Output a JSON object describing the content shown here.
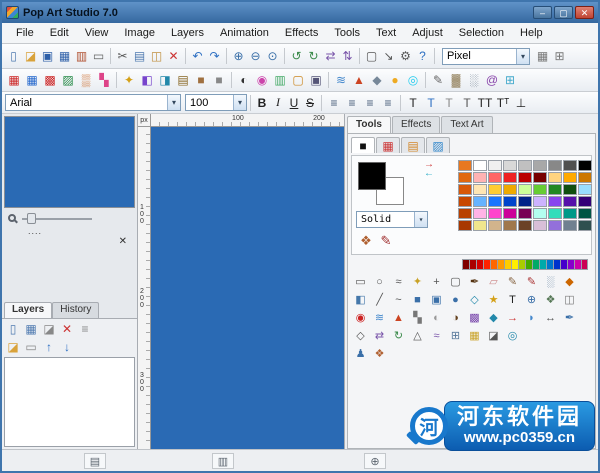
{
  "window": {
    "title": "Pop Art Studio 7.0",
    "minimize_glyph": "–",
    "maximize_glyph": "▢",
    "close_glyph": "✕"
  },
  "menu": {
    "items": [
      "File",
      "Edit",
      "View",
      "Image",
      "Layers",
      "Animation",
      "Effects",
      "Tools",
      "Text",
      "Adjust",
      "Selection",
      "Help"
    ]
  },
  "ui": {
    "dropdown_arrow": "▾"
  },
  "toolbar1": {
    "unit_value": "Pixel",
    "groups": [
      [
        {
          "n": "new-document-icon",
          "g": "▯",
          "c": "#4f7ab0"
        },
        {
          "n": "open-folder-icon",
          "g": "◪",
          "c": "#d9a23a"
        },
        {
          "n": "save-icon",
          "g": "▣",
          "c": "#2d5fa8"
        },
        {
          "n": "save-all-icon",
          "g": "▦",
          "c": "#2d5fa8"
        },
        {
          "n": "export-icon",
          "g": "▥",
          "c": "#b05030"
        },
        {
          "n": "print-icon",
          "g": "▭",
          "c": "#666666"
        }
      ],
      [
        {
          "n": "cut-icon",
          "g": "✂",
          "c": "#555555"
        },
        {
          "n": "copy-icon",
          "g": "▤",
          "c": "#4f7ab0"
        },
        {
          "n": "paste-icon",
          "g": "◫",
          "c": "#c09040"
        },
        {
          "n": "delete-icon",
          "g": "✕",
          "c": "#cc3333"
        }
      ],
      [
        {
          "n": "undo-icon",
          "g": "↶",
          "c": "#2d6fc2"
        },
        {
          "n": "redo-icon",
          "g": "↷",
          "c": "#2d6fc2"
        }
      ],
      [
        {
          "n": "zoom-in-icon",
          "g": "⊕",
          "c": "#3a6fa8"
        },
        {
          "n": "zoom-out-icon",
          "g": "⊖",
          "c": "#3a6fa8"
        },
        {
          "n": "zoom-actual-icon",
          "g": "⊙",
          "c": "#3a6fa8"
        }
      ],
      [
        {
          "n": "rotate-left-icon",
          "g": "↺",
          "c": "#3a8a4a"
        },
        {
          "n": "rotate-right-icon",
          "g": "↻",
          "c": "#3a8a4a"
        },
        {
          "n": "flip-horizontal-icon",
          "g": "⇄",
          "c": "#7a55aa"
        },
        {
          "n": "flip-vertical-icon",
          "g": "⇅",
          "c": "#7a55aa"
        }
      ],
      [
        {
          "n": "crop-icon",
          "g": "▢",
          "c": "#555555"
        },
        {
          "n": "resize-icon",
          "g": "↘",
          "c": "#555555"
        },
        {
          "n": "gear-icon",
          "g": "⚙",
          "c": "#555555"
        },
        {
          "n": "help-icon",
          "g": "?",
          "c": "#2d6fc2"
        }
      ],
      [
        {
          "n": "grid-icon",
          "g": "▦",
          "c": "#777777"
        },
        {
          "n": "table-icon",
          "g": "⊞",
          "c": "#777777"
        }
      ]
    ]
  },
  "toolbar2": {
    "groups": [
      [
        {
          "n": "popart-effect-icon",
          "g": "▦",
          "c": "#cc2222"
        },
        {
          "n": "warhol-effect-icon",
          "g": "▦",
          "c": "#2266cc"
        },
        {
          "n": "flag-effect-icon",
          "g": "▩",
          "c": "#cc2222"
        },
        {
          "n": "checker-effect-icon",
          "g": "▨",
          "c": "#228844"
        },
        {
          "n": "halftone-effect-icon",
          "g": "▒",
          "c": "#cc6622"
        },
        {
          "n": "comic-effect-icon",
          "g": "▚",
          "c": "#dd4488"
        }
      ],
      [
        {
          "n": "stars-effect-icon",
          "g": "✦",
          "c": "#d4a017"
        },
        {
          "n": "rainbow-effect-icon",
          "g": "◧",
          "c": "#7744cc"
        },
        {
          "n": "gradient-effect-icon",
          "g": "◨",
          "c": "#2288aa"
        },
        {
          "n": "mosaic-effect-icon",
          "g": "▤",
          "c": "#886622"
        },
        {
          "n": "sepia-effect-icon",
          "g": "■",
          "c": "#a07040"
        },
        {
          "n": "grayscale-effect-icon",
          "g": "■",
          "c": "#888888"
        }
      ],
      [
        {
          "n": "invert-effect-icon",
          "g": "◐",
          "c": "#333333"
        },
        {
          "n": "colorize-effect-icon",
          "g": "◉",
          "c": "#cc44aa"
        },
        {
          "n": "posterize-effect-icon",
          "g": "▥",
          "c": "#44aa66"
        },
        {
          "n": "frame-effect-icon",
          "g": "▢",
          "c": "#cc8822"
        },
        {
          "n": "shadow-effect-icon",
          "g": "▣",
          "c": "#555577"
        }
      ],
      [
        {
          "n": "blur-effect-icon",
          "g": "≋",
          "c": "#4488cc"
        },
        {
          "n": "sharpen-effect-icon",
          "g": "▲",
          "c": "#cc4422"
        },
        {
          "n": "emboss-effect-icon",
          "g": "◆",
          "c": "#778899"
        },
        {
          "n": "glow-effect-icon",
          "g": "●",
          "c": "#eeaa22"
        },
        {
          "n": "neon-effect-icon",
          "g": "◎",
          "c": "#22ccee"
        }
      ],
      [
        {
          "n": "sketch-effect-icon",
          "g": "✎",
          "c": "#666666"
        },
        {
          "n": "canvas-effect-icon",
          "g": "▓",
          "c": "#998866"
        },
        {
          "n": "noise-effect-icon",
          "g": "░",
          "c": "#667788"
        },
        {
          "n": "swirl-effect-icon",
          "g": "@",
          "c": "#8844aa"
        },
        {
          "n": "tile-effect-icon",
          "g": "⊞",
          "c": "#44aacc"
        }
      ]
    ]
  },
  "fontbar": {
    "font_name": "Arial",
    "font_size": "100",
    "style_buttons": [
      "B",
      "I",
      "U",
      "S"
    ],
    "align_icons": [
      {
        "n": "align-left-icon",
        "g": "≡",
        "c": "#445a77"
      },
      {
        "n": "align-center-icon",
        "g": "≡",
        "c": "#445a77"
      },
      {
        "n": "align-right-icon",
        "g": "≡",
        "c": "#445a77"
      },
      {
        "n": "align-justify-icon",
        "g": "≡",
        "c": "#445a77"
      }
    ],
    "text_icons": [
      {
        "n": "text-plain-icon",
        "g": "T",
        "c": "#222222"
      },
      {
        "n": "text-color-icon",
        "g": "T",
        "c": "#2d6fc2"
      },
      {
        "n": "text-outline-icon",
        "g": "T",
        "c": "#888888"
      },
      {
        "n": "text-shadow-icon",
        "g": "T",
        "c": "#555555"
      },
      {
        "n": "text-caps-icon",
        "g": "TT",
        "c": "#222222"
      },
      {
        "n": "text-superscript-icon",
        "g": "Tᵀ",
        "c": "#222222"
      },
      {
        "n": "text-rotate-icon",
        "g": "⊥",
        "c": "#222222"
      }
    ]
  },
  "left": {
    "dots_label": "....",
    "close_glyph": "✕",
    "tabs": [
      "Layers",
      "History"
    ],
    "layer_icons_row1": [
      {
        "n": "new-layer-icon",
        "g": "▯",
        "c": "#4f7ab0"
      },
      {
        "n": "duplicate-layer-icon",
        "g": "▦",
        "c": "#4f7ab0"
      },
      {
        "n": "layer-mask-icon",
        "g": "◪",
        "c": "#888888"
      },
      {
        "n": "delete-layer-icon",
        "g": "✕",
        "c": "#cc3333"
      },
      {
        "n": "merge-layers-icon",
        "g": "≡",
        "c": "#888888"
      }
    ],
    "layer_icons_row2": [
      {
        "n": "layer-folder-icon",
        "g": "◪",
        "c": "#d9a23a"
      },
      {
        "n": "flatten-icon",
        "g": "▭",
        "c": "#888888"
      },
      {
        "n": "layer-up-icon",
        "g": "↑",
        "c": "#2d6fc2"
      },
      {
        "n": "layer-down-icon",
        "g": "↓",
        "c": "#2d6fc2"
      }
    ]
  },
  "canvas": {
    "unit": "px",
    "h_labels": [
      "100",
      "200"
    ],
    "v_labels": [
      "1\n0\n0",
      "2\n0\n0",
      "3\n0\n0"
    ],
    "color": "#2a6ab4"
  },
  "right": {
    "tabs": [
      "Tools",
      "Effects",
      "Text Art"
    ],
    "palette_tabs": [
      {
        "n": "palette-tab-solid-icon",
        "g": "■",
        "c": "#111111"
      },
      {
        "n": "palette-tab-swatch-icon",
        "g": "▦",
        "c": "#cc3333"
      },
      {
        "n": "palette-tab-mixer-icon",
        "g": "▤",
        "c": "#d4882a"
      },
      {
        "n": "palette-tab-web-icon",
        "g": "▨",
        "c": "#3388cc"
      }
    ],
    "foreground_color": "#000000",
    "background_color": "#ffffff",
    "swap_glyph1": "→",
    "swap_glyph2": "←",
    "fill_style": "Solid",
    "palette_icons": [
      {
        "n": "artist-palette-icon",
        "g": "❖",
        "c": "#b06030"
      },
      {
        "n": "brushes-icon",
        "g": "✎",
        "c": "#a03030"
      }
    ],
    "palette_rows": [
      [
        "#e87820",
        "#ffffff",
        "#f0f0f0",
        "#d8d8d8",
        "#c0c0c0",
        "#a8a8a8",
        "#888888",
        "#505050",
        "#000000"
      ],
      [
        "#e06810",
        "#ffb3b3",
        "#ff6666",
        "#ee2222",
        "#bb0000",
        "#770000",
        "#ffd480",
        "#ffaa00",
        "#cc7700"
      ],
      [
        "#d85808",
        "#ffe6b3",
        "#ffcc33",
        "#eeaa00",
        "#ccff99",
        "#66cc33",
        "#228822",
        "#0f4f0f",
        "#99ddff"
      ],
      [
        "#c84800",
        "#66b3ff",
        "#1a75ff",
        "#0044cc",
        "#002288",
        "#ccb3ff",
        "#8844ee",
        "#5511aa",
        "#330077"
      ],
      [
        "#b84000",
        "#ffb3e6",
        "#ff44cc",
        "#cc0099",
        "#770055",
        "#b3fff0",
        "#33ddbb",
        "#009988",
        "#005544"
      ],
      [
        "#a83800",
        "#f0e68c",
        "#d2b48c",
        "#a0784c",
        "#6b4226",
        "#d8bfd8",
        "#9370db",
        "#708090",
        "#2f4f4f"
      ]
    ],
    "strip": [
      "#7f0000",
      "#aa0000",
      "#d40000",
      "#ff2200",
      "#ff6600",
      "#ff9900",
      "#ffcc00",
      "#ffee00",
      "#aacc00",
      "#44aa00",
      "#00aa66",
      "#00aaaa",
      "#0077cc",
      "#0033cc",
      "#4400cc",
      "#8800cc",
      "#cc00aa",
      "#cc0055"
    ],
    "tool_rows": [
      [
        {
          "n": "rect-select-icon",
          "g": "▭",
          "c": "#555555"
        },
        {
          "n": "ellipse-select-icon",
          "g": "○",
          "c": "#555555"
        },
        {
          "n": "lasso-icon",
          "g": "≈",
          "c": "#555555"
        },
        {
          "n": "magic-wand-icon",
          "g": "✦",
          "c": "#c9a227"
        },
        {
          "n": "move-icon",
          "g": "+",
          "c": "#555555"
        },
        {
          "n": "crop-tool-icon",
          "g": "▢",
          "c": "#555555"
        },
        {
          "n": "eyedropper-icon",
          "g": "✒",
          "c": "#553311"
        },
        {
          "n": "eraser-icon",
          "g": "▱",
          "c": "#cc8888"
        },
        {
          "n": "pencil-icon",
          "g": "✎",
          "c": "#886644"
        },
        {
          "n": "brush-icon",
          "g": "✎",
          "c": "#aa3333"
        },
        {
          "n": "airbrush-icon",
          "g": "░",
          "c": "#557799"
        },
        {
          "n": "fill-icon",
          "g": "◆",
          "c": "#cc6600"
        }
      ],
      [
        {
          "n": "gradient-icon",
          "g": "◧",
          "c": "#4477aa"
        },
        {
          "n": "line-icon",
          "g": "╱",
          "c": "#555555"
        },
        {
          "n": "curve-icon",
          "g": "~",
          "c": "#555555"
        },
        {
          "n": "rectangle-icon",
          "g": "■",
          "c": "#3a6fa8"
        },
        {
          "n": "rounded-rect-icon",
          "g": "▣",
          "c": "#3a6fa8"
        },
        {
          "n": "ellipse-icon",
          "g": "●",
          "c": "#3a6fa8"
        },
        {
          "n": "polygon-icon",
          "g": "◇",
          "c": "#2288aa"
        },
        {
          "n": "star-icon",
          "g": "★",
          "c": "#d4a017"
        },
        {
          "n": "text-tool-icon",
          "g": "T",
          "c": "#222222"
        },
        {
          "n": "zoom-tool-icon",
          "g": "⊕",
          "c": "#3a6fa8"
        },
        {
          "n": "pan-icon",
          "g": "❖",
          "c": "#557755"
        },
        {
          "n": "clone-stamp-icon",
          "g": "◫",
          "c": "#777777"
        }
      ],
      [
        {
          "n": "red-eye-icon",
          "g": "◉",
          "c": "#cc2222"
        },
        {
          "n": "blur-icon",
          "g": "≋",
          "c": "#4488cc"
        },
        {
          "n": "sharpen-icon",
          "g": "▲",
          "c": "#cc4422"
        },
        {
          "n": "smudge-icon",
          "g": "▚",
          "c": "#777777"
        },
        {
          "n": "dodge-icon",
          "g": "◐",
          "c": "#999999"
        },
        {
          "n": "burn-icon",
          "g": "◑",
          "c": "#664422"
        },
        {
          "n": "pattern-icon",
          "g": "▩",
          "c": "#7744aa"
        },
        {
          "n": "shape-icon",
          "g": "◆",
          "c": "#2288aa"
        },
        {
          "n": "arrow-icon",
          "g": "→",
          "c": "#cc3333"
        },
        {
          "n": "callout-icon",
          "g": "◗",
          "c": "#4488cc"
        },
        {
          "n": "measure-icon",
          "g": "↔",
          "c": "#555555"
        },
        {
          "n": "pen-icon",
          "g": "✒",
          "c": "#3a6fa8"
        }
      ],
      [
        {
          "n": "node-edit-icon",
          "g": "◇",
          "c": "#555555"
        },
        {
          "n": "mirror-icon",
          "g": "⇄",
          "c": "#7a55aa"
        },
        {
          "n": "rotate-tool-icon",
          "g": "↻",
          "c": "#3a8a4a"
        },
        {
          "n": "perspective-icon",
          "g": "△",
          "c": "#555555"
        },
        {
          "n": "warp-icon",
          "g": "≈",
          "c": "#7a55aa"
        },
        {
          "n": "mesh-icon",
          "g": "⊞",
          "c": "#557799"
        },
        {
          "n": "frame-icon",
          "g": "▦",
          "c": "#c9a227"
        },
        {
          "n": "mask-icon",
          "g": "◪",
          "c": "#555555"
        },
        {
          "n": "color-picker-icon",
          "g": "◎",
          "c": "#2288aa"
        }
      ],
      [
        {
          "n": "person-icon",
          "g": "♟",
          "c": "#3a6fa8"
        },
        {
          "n": "mini-palette-icon",
          "g": "❖",
          "c": "#b06030"
        }
      ]
    ]
  },
  "statusbar": {
    "icons": [
      {
        "n": "status-doc-icon",
        "g": "▤"
      },
      {
        "n": "status-frame-icon",
        "g": "▥"
      },
      {
        "n": "status-zoom-icon",
        "g": "⊕"
      }
    ]
  },
  "watermark": {
    "icon_char": "河",
    "line1": "河东软件园",
    "line2": "www.pc0359.cn",
    "color": "#1473c8"
  }
}
